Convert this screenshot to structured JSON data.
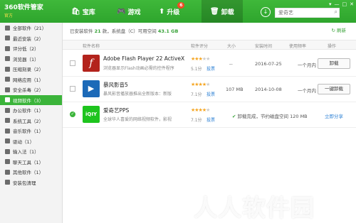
{
  "app": {
    "name": "360软件管家",
    "sub": "官方"
  },
  "nav": [
    {
      "icon": "store-icon",
      "label": "宝库"
    },
    {
      "icon": "gamepad-icon",
      "label": "游戏"
    },
    {
      "icon": "upgrade-icon",
      "label": "升级",
      "badge": "6"
    },
    {
      "icon": "trash-icon",
      "label": "卸载"
    }
  ],
  "search": {
    "placeholder": "爱奇艺"
  },
  "window_buttons": [
    "▾",
    "—",
    "□",
    "✕"
  ],
  "sidebar": [
    {
      "label": "全部软件（21）"
    },
    {
      "label": "最近安装（2）"
    },
    {
      "label": "评分低（2）"
    },
    {
      "label": "浏览器（1）"
    },
    {
      "label": "压缩刻录（2）"
    },
    {
      "label": "网络应用（1）"
    },
    {
      "label": "安全杀毒（2）"
    },
    {
      "label": "视频软件（3）",
      "active": true
    },
    {
      "label": "办公软件（1）"
    },
    {
      "label": "系统工具（2）"
    },
    {
      "label": "音乐软件（1）"
    },
    {
      "label": "驱动（1）"
    },
    {
      "label": "输入法（1）"
    },
    {
      "label": "聊天工具（1）"
    },
    {
      "label": "其他软件（1）"
    },
    {
      "label": "安装包清理"
    }
  ],
  "summary": {
    "prefix": "已安装软件",
    "count": "21",
    "count_unit": "款，系统盘（C）可用空间",
    "free": "43.1 GB"
  },
  "refresh_label": "刷新",
  "table_headers": {
    "name": "软件名称",
    "rating": "软件评分",
    "size": "大小",
    "date": "安装时间",
    "frequency": "使用频率",
    "action": "操作"
  },
  "rows": [
    {
      "name": "Adobe Flash Player 22 ActiveX",
      "desc": "浏览器显示Flash动画必需的控件程序",
      "rating": 5.1,
      "score": "5.1分",
      "vote": "投票",
      "size": "--",
      "date": "2016-07-25",
      "freq": "一个月内",
      "action": "卸载",
      "checked": false,
      "icon_color": "#b3231c",
      "icon_text": "f"
    },
    {
      "name": "暴风影音5",
      "desc": "暴风影音播放器推出全新版本：新版",
      "rating": 7.1,
      "score": "7.1分",
      "vote": "投票",
      "size": "107 MB",
      "date": "2014-10-08",
      "freq": "一个月内",
      "action": "一键卸载",
      "checked": false,
      "icon_color": "#1c6ab8",
      "icon_text": "▶"
    },
    {
      "name": "爱奇艺PPS",
      "desc": "全球华人喜爱的网络视频软件，影视",
      "rating": 7.1,
      "score": "7.1分",
      "vote": "投票",
      "done": "卸载完成，节约磁盘空间 120 MB",
      "action": "立即分享",
      "checked": true,
      "icon_color": "#1ec41e",
      "icon_text": "iQIY"
    }
  ],
  "watermark": "人人软件园"
}
